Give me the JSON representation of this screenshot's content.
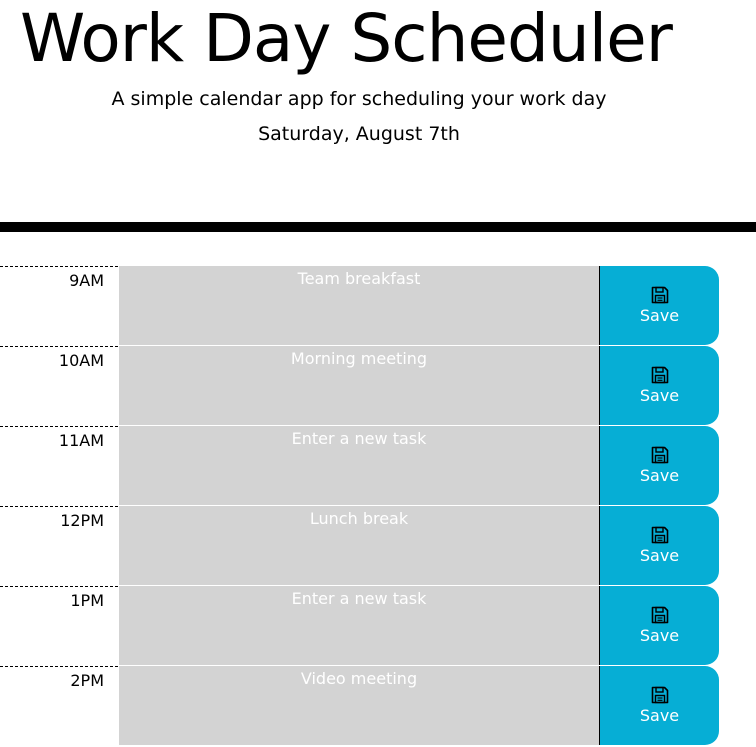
{
  "header": {
    "title": "Work Day Scheduler",
    "subtitle": "A simple calendar app for scheduling your work day",
    "current_date": "Saturday, August 7th"
  },
  "colors": {
    "accent": "#06aed5",
    "past_block": "#d3d3d3"
  },
  "save_icon": "floppy-disk-icon",
  "rows": [
    {
      "hour": "9AM",
      "task": "Team breakfast",
      "save_label": "Save"
    },
    {
      "hour": "10AM",
      "task": "Morning meeting",
      "save_label": "Save"
    },
    {
      "hour": "11AM",
      "task": "Enter a new task",
      "save_label": "Save"
    },
    {
      "hour": "12PM",
      "task": "Lunch break",
      "save_label": "Save"
    },
    {
      "hour": "1PM",
      "task": "Enter a new task",
      "save_label": "Save"
    },
    {
      "hour": "2PM",
      "task": "Video meeting",
      "save_label": "Save"
    }
  ]
}
